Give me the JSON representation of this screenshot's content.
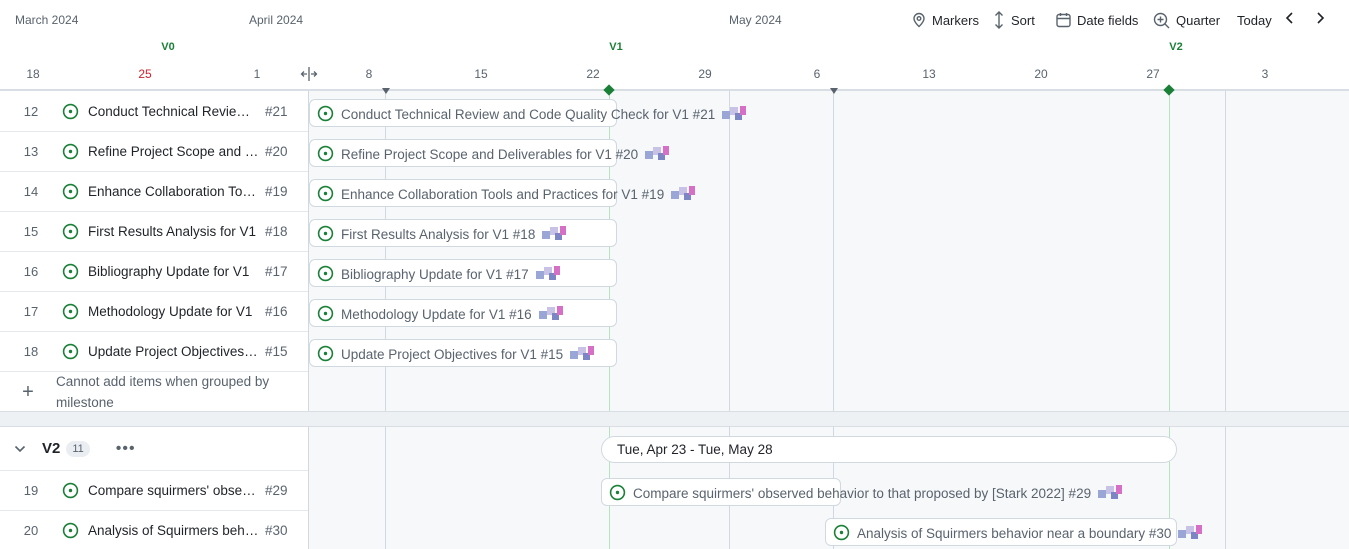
{
  "header": {
    "months": [
      "March 2024",
      "April 2024",
      "May 2024"
    ],
    "milestones": [
      "V0",
      "V1",
      "V2"
    ],
    "days": [
      "18",
      "25",
      "1",
      "8",
      "15",
      "22",
      "29",
      "6",
      "13",
      "20",
      "27",
      "3"
    ]
  },
  "toolbar": {
    "markers": "Markers",
    "sort": "Sort",
    "date_fields": "Date fields",
    "zoom": "Quarter",
    "today": "Today"
  },
  "group_v1": {
    "rows": [
      {
        "num": "12",
        "title": "Conduct Technical Review and Code Quality Check for V1",
        "id": "#21",
        "bar": "Conduct Technical Review and Code Quality Check for V1 #21"
      },
      {
        "num": "13",
        "title": "Refine Project Scope and Deliverables for V1",
        "id": "#20",
        "bar": "Refine Project Scope and Deliverables for V1 #20"
      },
      {
        "num": "14",
        "title": "Enhance Collaboration Tools and Practices for V1",
        "id": "#19",
        "bar": "Enhance Collaboration Tools and Practices for V1 #19"
      },
      {
        "num": "15",
        "title": "First Results Analysis for V1",
        "id": "#18",
        "bar": "First Results Analysis for V1 #18"
      },
      {
        "num": "16",
        "title": "Bibliography Update for V1",
        "id": "#17",
        "bar": "Bibliography Update for V1 #17"
      },
      {
        "num": "17",
        "title": "Methodology Update for V1",
        "id": "#16",
        "bar": "Methodology Update for V1 #16"
      },
      {
        "num": "18",
        "title": "Update Project Objectives for V1",
        "id": "#15",
        "bar": "Update Project Objectives for V1 #15"
      }
    ],
    "add_note": "Cannot add items when grouped by milestone"
  },
  "group_v2": {
    "name": "V2",
    "count": "11",
    "date_range": "Tue, Apr 23 - Tue, May 28",
    "rows": [
      {
        "num": "19",
        "title": "Compare squirmers' observed behavior to that proposed by [Stark 2022]",
        "id": "#29",
        "bar": "Compare squirmers' observed behavior to that proposed by [Stark 2022] #29"
      },
      {
        "num": "20",
        "title": "Analysis of Squirmers behavior near a boundary",
        "id": "#30",
        "bar": "Analysis of Squirmers behavior near a boundary #30"
      }
    ]
  },
  "colors": {
    "accent_green": "#1a7f37",
    "weekend_red": "#cf222e"
  }
}
